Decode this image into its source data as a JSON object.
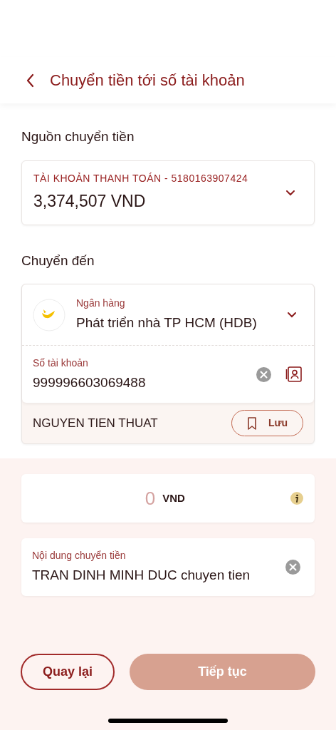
{
  "header": {
    "title": "Chuyển tiền tới số tài khoản"
  },
  "source": {
    "label": "Nguồn chuyển tiền",
    "account": "TÀI KHOẢN THANH TOÁN - 5180163907424",
    "balance": "3,374,507 VND"
  },
  "destination": {
    "label": "Chuyển đến",
    "bank_label": "Ngân hàng",
    "bank": "Phát triển nhà TP HCM (HDB)",
    "account_label": "Số tài khoản",
    "account_number": "999996603069488",
    "holder": "NGUYEN TIEN THUAT",
    "save_button": "Lưu"
  },
  "amount": {
    "placeholder": "0",
    "currency": "VND"
  },
  "memo": {
    "label": "Nội dung chuyển tiền",
    "value": "TRAN DINH MINH DUC chuyen tien"
  },
  "buttons": [
    {
      "label": "Quay lại",
      "kind": "secondary",
      "disabled": false
    },
    {
      "label": "Tiếp tục",
      "kind": "primary",
      "disabled": true
    }
  ]
}
